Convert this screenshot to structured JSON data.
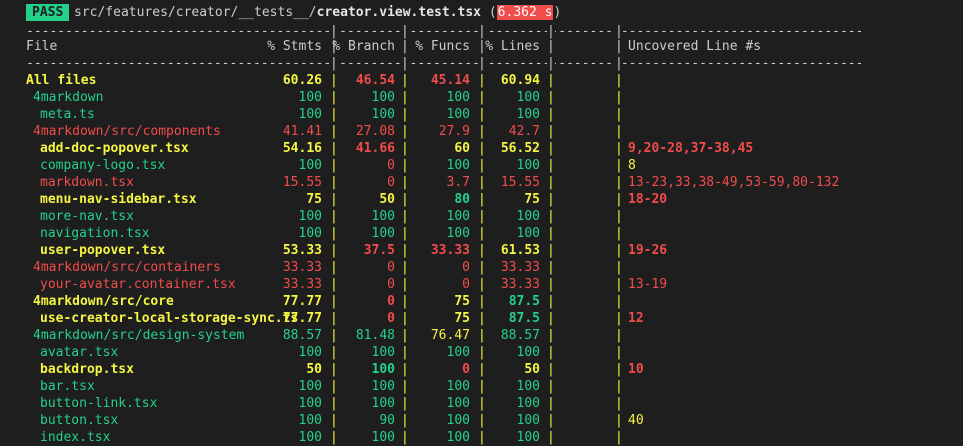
{
  "header": {
    "status": "PASS",
    "path_prefix": "src/features/creator/__tests__/",
    "file_name": "creator.view.test.tsx",
    "open_paren": "(",
    "duration": "6.362 s",
    "close_paren": ")"
  },
  "separator": "------------------------------------------------------------------------------------------------------------",
  "columns": {
    "file": "File",
    "stmts": "% Stmts",
    "branch": "% Branch",
    "funcs": "% Funcs",
    "lines": "% Lines",
    "uncovered": "Uncovered Line #s"
  },
  "rows": [
    {
      "file": "All files",
      "indent": 0,
      "color": "yellow",
      "bold": true,
      "stmts": "60.26",
      "stmts_c": "yellow",
      "branch": "46.54",
      "branch_c": "red",
      "funcs": "45.14",
      "funcs_c": "red",
      "lines": "60.94",
      "lines_c": "yellow",
      "uncovered": "",
      "unc_c": "yellow"
    },
    {
      "file": "4markdown",
      "indent": 1,
      "color": "green",
      "stmts": "100",
      "stmts_c": "green",
      "branch": "100",
      "branch_c": "green",
      "funcs": "100",
      "funcs_c": "green",
      "lines": "100",
      "lines_c": "green",
      "uncovered": "",
      "unc_c": "green"
    },
    {
      "file": "meta.ts",
      "indent": 2,
      "color": "green",
      "stmts": "100",
      "stmts_c": "green",
      "branch": "100",
      "branch_c": "green",
      "funcs": "100",
      "funcs_c": "green",
      "lines": "100",
      "lines_c": "green",
      "uncovered": "",
      "unc_c": "green"
    },
    {
      "file": "4markdown/src/components",
      "indent": 1,
      "color": "red",
      "stmts": "41.41",
      "stmts_c": "red",
      "branch": "27.08",
      "branch_c": "red",
      "funcs": "27.9",
      "funcs_c": "red",
      "lines": "42.7",
      "lines_c": "red",
      "uncovered": "",
      "unc_c": "red"
    },
    {
      "file": "add-doc-popover.tsx",
      "indent": 2,
      "color": "yellow",
      "bold": true,
      "stmts": "54.16",
      "stmts_c": "yellow",
      "branch": "41.66",
      "branch_c": "red",
      "funcs": "60",
      "funcs_c": "yellow",
      "lines": "56.52",
      "lines_c": "yellow",
      "uncovered": "9,20-28,37-38,45",
      "unc_c": "red"
    },
    {
      "file": "company-logo.tsx",
      "indent": 2,
      "color": "green",
      "stmts": "100",
      "stmts_c": "green",
      "branch": "0",
      "branch_c": "red",
      "funcs": "100",
      "funcs_c": "green",
      "lines": "100",
      "lines_c": "green",
      "uncovered": "8",
      "unc_c": "yellow"
    },
    {
      "file": "markdown.tsx",
      "indent": 2,
      "color": "red",
      "stmts": "15.55",
      "stmts_c": "red",
      "branch": "0",
      "branch_c": "red",
      "funcs": "3.7",
      "funcs_c": "red",
      "lines": "15.55",
      "lines_c": "red",
      "uncovered": "13-23,33,38-49,53-59,80-132",
      "unc_c": "red"
    },
    {
      "file": "menu-nav-sidebar.tsx",
      "indent": 2,
      "color": "yellow",
      "bold": true,
      "stmts": "75",
      "stmts_c": "yellow",
      "branch": "50",
      "branch_c": "yellow",
      "funcs": "80",
      "funcs_c": "green",
      "lines": "75",
      "lines_c": "yellow",
      "uncovered": "18-20",
      "unc_c": "red"
    },
    {
      "file": "more-nav.tsx",
      "indent": 2,
      "color": "green",
      "stmts": "100",
      "stmts_c": "green",
      "branch": "100",
      "branch_c": "green",
      "funcs": "100",
      "funcs_c": "green",
      "lines": "100",
      "lines_c": "green",
      "uncovered": "",
      "unc_c": "green"
    },
    {
      "file": "navigation.tsx",
      "indent": 2,
      "color": "green",
      "stmts": "100",
      "stmts_c": "green",
      "branch": "100",
      "branch_c": "green",
      "funcs": "100",
      "funcs_c": "green",
      "lines": "100",
      "lines_c": "green",
      "uncovered": "",
      "unc_c": "green"
    },
    {
      "file": "user-popover.tsx",
      "indent": 2,
      "color": "yellow",
      "bold": true,
      "stmts": "53.33",
      "stmts_c": "yellow",
      "branch": "37.5",
      "branch_c": "red",
      "funcs": "33.33",
      "funcs_c": "red",
      "lines": "61.53",
      "lines_c": "yellow",
      "uncovered": "19-26",
      "unc_c": "red"
    },
    {
      "file": "4markdown/src/containers",
      "indent": 1,
      "color": "red",
      "stmts": "33.33",
      "stmts_c": "red",
      "branch": "0",
      "branch_c": "red",
      "funcs": "0",
      "funcs_c": "red",
      "lines": "33.33",
      "lines_c": "red",
      "uncovered": "",
      "unc_c": "red"
    },
    {
      "file": "your-avatar.container.tsx",
      "indent": 2,
      "color": "red",
      "stmts": "33.33",
      "stmts_c": "red",
      "branch": "0",
      "branch_c": "red",
      "funcs": "0",
      "funcs_c": "red",
      "lines": "33.33",
      "lines_c": "red",
      "uncovered": "13-19",
      "unc_c": "red"
    },
    {
      "file": "4markdown/src/core",
      "indent": 1,
      "color": "yellow",
      "bold": true,
      "stmts": "77.77",
      "stmts_c": "yellow",
      "branch": "0",
      "branch_c": "red",
      "funcs": "75",
      "funcs_c": "yellow",
      "lines": "87.5",
      "lines_c": "green",
      "uncovered": "",
      "unc_c": "yellow"
    },
    {
      "file": "use-creator-local-storage-sync.ts",
      "indent": 2,
      "color": "yellow",
      "bold": true,
      "stmts": "77.77",
      "stmts_c": "yellow",
      "branch": "0",
      "branch_c": "red",
      "funcs": "75",
      "funcs_c": "yellow",
      "lines": "87.5",
      "lines_c": "green",
      "uncovered": "12",
      "unc_c": "red"
    },
    {
      "file": "4markdown/src/design-system",
      "indent": 1,
      "color": "green",
      "stmts": "88.57",
      "stmts_c": "green",
      "branch": "81.48",
      "branch_c": "green",
      "funcs": "76.47",
      "funcs_c": "yellow",
      "lines": "88.57",
      "lines_c": "green",
      "uncovered": "",
      "unc_c": "green"
    },
    {
      "file": "avatar.tsx",
      "indent": 2,
      "color": "green",
      "stmts": "100",
      "stmts_c": "green",
      "branch": "100",
      "branch_c": "green",
      "funcs": "100",
      "funcs_c": "green",
      "lines": "100",
      "lines_c": "green",
      "uncovered": "",
      "unc_c": "green"
    },
    {
      "file": "backdrop.tsx",
      "indent": 2,
      "color": "yellow",
      "bold": true,
      "stmts": "50",
      "stmts_c": "yellow",
      "branch": "100",
      "branch_c": "green",
      "funcs": "0",
      "funcs_c": "red",
      "lines": "50",
      "lines_c": "yellow",
      "uncovered": "10",
      "unc_c": "red"
    },
    {
      "file": "bar.tsx",
      "indent": 2,
      "color": "green",
      "stmts": "100",
      "stmts_c": "green",
      "branch": "100",
      "branch_c": "green",
      "funcs": "100",
      "funcs_c": "green",
      "lines": "100",
      "lines_c": "green",
      "uncovered": "",
      "unc_c": "green"
    },
    {
      "file": "button-link.tsx",
      "indent": 2,
      "color": "green",
      "stmts": "100",
      "stmts_c": "green",
      "branch": "100",
      "branch_c": "green",
      "funcs": "100",
      "funcs_c": "green",
      "lines": "100",
      "lines_c": "green",
      "uncovered": "",
      "unc_c": "green"
    },
    {
      "file": "button.tsx",
      "indent": 2,
      "color": "green",
      "stmts": "100",
      "stmts_c": "green",
      "branch": "90",
      "branch_c": "green",
      "funcs": "100",
      "funcs_c": "green",
      "lines": "100",
      "lines_c": "green",
      "uncovered": "40",
      "unc_c": "yellow"
    },
    {
      "file": "index.tsx",
      "indent": 2,
      "color": "green",
      "stmts": "100",
      "stmts_c": "green",
      "branch": "100",
      "branch_c": "green",
      "funcs": "100",
      "funcs_c": "green",
      "lines": "100",
      "lines_c": "green",
      "uncovered": "",
      "unc_c": "green"
    }
  ],
  "colors": {
    "background": "#1e1e1e",
    "green": "#23d18b",
    "yellow": "#f5f543",
    "red": "#f14c4c",
    "text": "#cccccc"
  }
}
